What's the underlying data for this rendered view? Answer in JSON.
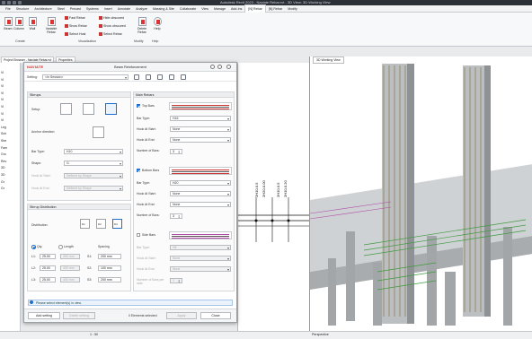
{
  "app": {
    "title": "Autodesk Revit 2023 - Naviate Rebar.rvt - 3D View: 3D Working View"
  },
  "tabs": [
    "File",
    "Structure",
    "Architecture",
    "Steel",
    "Precast",
    "Systems",
    "Insert",
    "Annotate",
    "Analyze",
    "Massing & Site",
    "Collaborate",
    "View",
    "Manage",
    "Add-Ins",
    "[N] Rebar",
    "[N] Rebar",
    "Modify"
  ],
  "active_tab": 14,
  "ribbon": {
    "big": [
      "Beam",
      "Column",
      "Wall",
      "Variable Rebar",
      "Shape Editor",
      "Delete Rebar",
      "Help"
    ],
    "small": [
      "Fast Rebar",
      "Show Rebar",
      "Select Host",
      "Hide obscured",
      "Show obscured",
      "Select Rebar"
    ],
    "groups": [
      "Create",
      "Visualization",
      "Modify",
      "Help"
    ]
  },
  "left_panel": {
    "tabs": [
      "Project Browser - Naviate Rebar.rvt",
      "Properties"
    ],
    "tree": [
      "Vi",
      "Vi",
      "Vi",
      "Vi",
      "Vi",
      "Vi",
      "Vi",
      "Vi",
      "Leg",
      "Sch",
      "She",
      "Fam",
      "Gro",
      "Rev",
      "3D",
      "3D",
      "Gr",
      "Gr"
    ]
  },
  "view_tabs": {
    "drawing": "{3D} - Default",
    "v3d": "3D Working View"
  },
  "dialog": {
    "brand": "NAVIATE",
    "title": "Beam Reinforcement",
    "setting_label": "Setting:",
    "setting_value": "<In Session>",
    "stirrups": {
      "header": "Stirrups",
      "setup": "Setup:",
      "anchor": "Anchor direction:",
      "bar_type": "Bar Type:",
      "bar_type_value": "H10",
      "shape": "Shape:",
      "shape_value": "I1",
      "hook_start": "Hook At Start:",
      "hook_start_value": "Defined by Shape",
      "hook_end": "Hook At End:",
      "hook_end_value": "Defined by Shape"
    },
    "distribution": {
      "header": "Stirrup Distribution",
      "label": "Distribution:",
      "dist_opt1": "D1",
      "dist_opt2": "D2",
      "dist_opt3": "D3",
      "radio_qty": "Qty.",
      "radio_length": "Length",
      "spacing": "Spacing",
      "rows": [
        {
          "l": "L1:",
          "v": "25.00",
          "q": "400 mm",
          "s": "S1:",
          "sv": "200 mm"
        },
        {
          "l": "L2:",
          "v": "25.00",
          "q": "400 mm",
          "s": "S2:",
          "sv": "100 mm"
        },
        {
          "l": "L3:",
          "v": "25.00",
          "q": "400 mm",
          "s": "S3:",
          "sv": "200 mm"
        }
      ]
    },
    "main_rebars": {
      "header": "Main Rebars",
      "top": {
        "label": "Top Bars",
        "bar_type": "Bar Type:",
        "bar_type_value": "H16",
        "hook_start": "Hook At Start:",
        "hook_start_value": "None",
        "hook_end": "Hook At End:",
        "hook_end_value": "None",
        "number": "Number of Bars:",
        "number_value": "3"
      },
      "bottom": {
        "label": "Bottom Bars",
        "bar_type": "Bar Type:",
        "bar_type_value": "H20",
        "hook_start": "Hook At Start:",
        "hook_start_value": "None",
        "hook_end": "Hook At End:",
        "hook_end_value": "None",
        "number": "Number of Bars:",
        "number_value": "3"
      },
      "side": {
        "label": "Side Bars",
        "bar_type": "Bar Type:",
        "bar_type_value": "H8",
        "hook_start": "Hook At Start:",
        "hook_start_value": "None",
        "hook_end": "Hook At End:",
        "hook_end_value": "None",
        "number": "Number of Bars per side:",
        "number_value": "1"
      }
    },
    "info": "Please select element(s) in view.",
    "footer": {
      "add_setting": "Add setting",
      "delete_setting": "Delete setting",
      "count": "0 Elements selected",
      "apply": "Apply",
      "close": "Close"
    }
  },
  "drawing_labels": [
    "2H10-0.5",
    "2H20-0.00",
    "2H10-0.5",
    "2H10-0.20"
  ],
  "status": {
    "scale": "1 : 50",
    "view_name": "Perspective"
  }
}
